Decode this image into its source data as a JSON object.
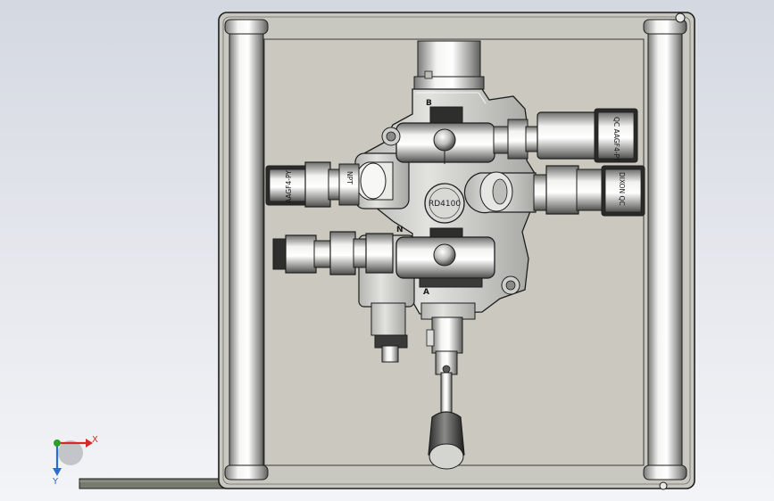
{
  "model": {
    "valve_label": "RD4100",
    "port_b": "B",
    "port_a": "A",
    "port_n": "N",
    "coupler_top_right": "QC AAGF4-PY",
    "coupler_mid_right": "DIXON QC",
    "coupler_left": "AAGF4-PY",
    "nipple_label": "NPT"
  },
  "triad": {
    "x_label": "X",
    "y_label": "Y",
    "x_color": "#d42a2a",
    "y_color": "#2a6cd4",
    "origin_color": "#2aa02a"
  },
  "colors": {
    "plate": "#c8c6bd",
    "metal_light": "#f0f0ee",
    "metal_dark": "#6d6d6b",
    "outline": "#1e1e1e"
  }
}
